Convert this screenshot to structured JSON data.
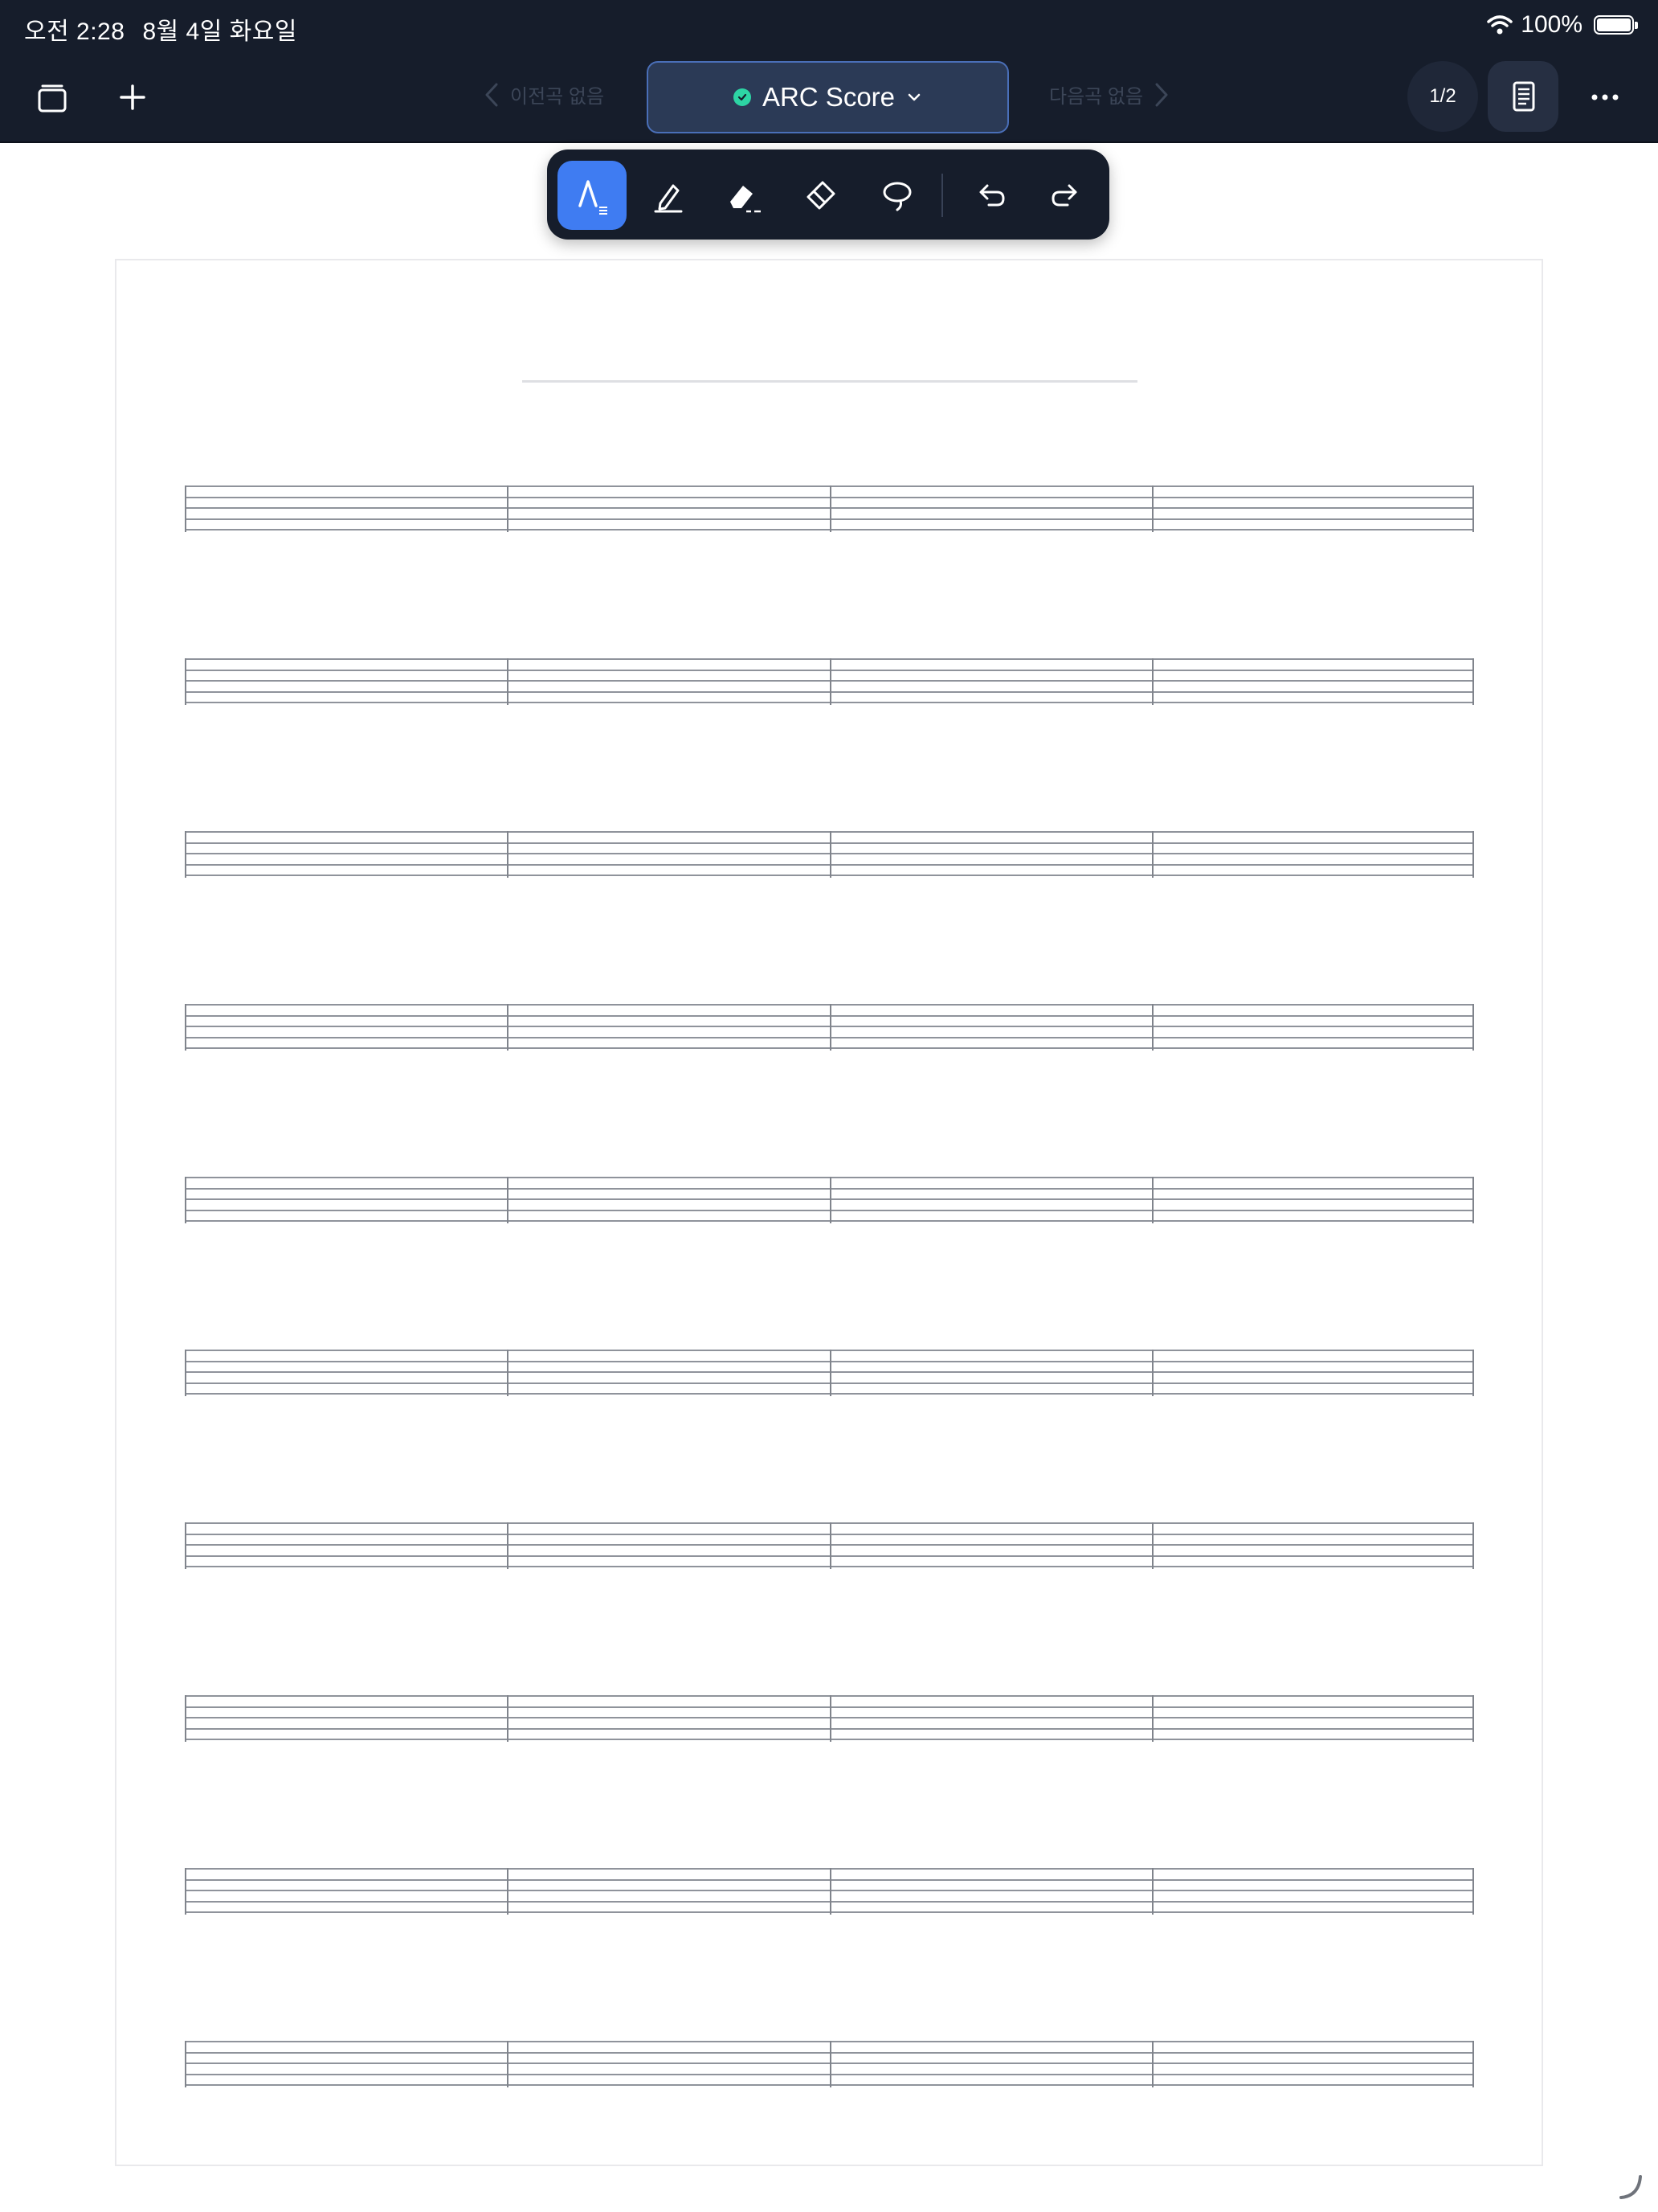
{
  "status_bar": {
    "time": "오전 2:28",
    "date": "8월 4일 화요일",
    "battery": "100%"
  },
  "nav": {
    "prev_label": "이전곡 없음",
    "next_label": "다음곡 없음",
    "title": "ARC Score",
    "page_indicator": "1/2"
  },
  "icons": {
    "library": "layers-icon",
    "add": "plus-icon",
    "score_view": "document-icon",
    "more": "ellipsis-icon"
  },
  "toolbar": {
    "tools": [
      "pen-tool",
      "highlighter-tool",
      "fill-eraser-tool",
      "eraser-tool",
      "lasso-tool"
    ],
    "actions": [
      "undo",
      "redo"
    ],
    "active_tool": "pen-tool",
    "active_color": "#3f7cf2"
  },
  "score": {
    "staff_count": 10,
    "measures_per_staff": 4,
    "lines_per_staff": 5
  },
  "colors": {
    "topbar": "#161d2b",
    "accent": "#3f7cf2",
    "status_ok": "#2dd4a4"
  }
}
